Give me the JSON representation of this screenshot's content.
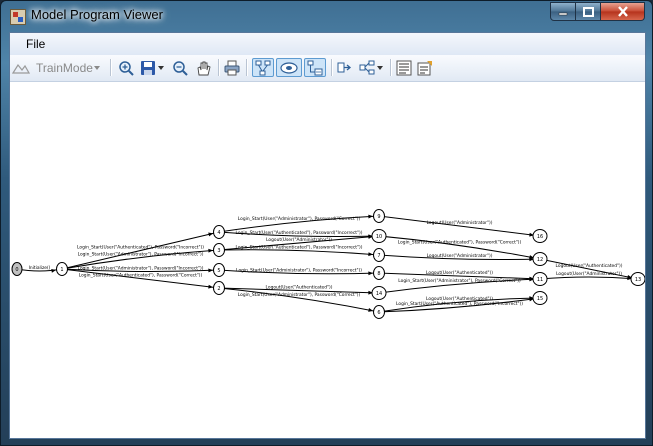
{
  "window": {
    "title": "Model Program Viewer"
  },
  "menubar": {
    "file": "File"
  },
  "toolbar": {
    "dropdown_value": "TrainMode",
    "buttons": [
      {
        "name": "zoom-in-icon",
        "pressed": false
      },
      {
        "name": "save-icon",
        "pressed": false
      },
      {
        "name": "zoom-out-icon",
        "pressed": false
      },
      {
        "name": "pan-hand-icon",
        "pressed": false
      },
      {
        "name": "print-icon",
        "pressed": false
      },
      {
        "name": "graph-layout-icon",
        "pressed": true
      },
      {
        "name": "state-view-icon",
        "pressed": true
      },
      {
        "name": "label-view-icon",
        "pressed": true
      },
      {
        "name": "direction-icon",
        "pressed": false
      },
      {
        "name": "graph-options-icon",
        "pressed": false
      },
      {
        "name": "list-icon",
        "pressed": false
      },
      {
        "name": "properties-icon",
        "pressed": false
      }
    ]
  },
  "graph": {
    "nodes": [
      "0",
      "1",
      "2",
      "3",
      "4",
      "5",
      "6",
      "7",
      "8",
      "9",
      "10",
      "11",
      "12",
      "13",
      "14",
      "15",
      "16"
    ],
    "edges": [
      {
        "from": "0",
        "to": "1",
        "label": "Initialize()"
      },
      {
        "from": "1",
        "to": "4",
        "label": "Login_Start(User(\"Authenticated\"), Password(\"Incorrect\"))"
      },
      {
        "from": "1",
        "to": "3",
        "label": "Login_Start(User(\"Administrator\"), Password(\"Incorrect\"))"
      },
      {
        "from": "1",
        "to": "5",
        "label": "Login_Start(User(\"Administrator\"), Password(\"Incorrect\"))"
      },
      {
        "from": "1",
        "to": "2",
        "label": "Login_Start(User(\"Authenticated\"), Password(\"Correct\"))"
      },
      {
        "from": "4",
        "to": "9",
        "label": "Login_Start(User(\"Administrator\"), Password(\"Correct\"))"
      },
      {
        "from": "4",
        "to": "10",
        "label": "Login_Start(User(\"Authenticated\"), Password(\"Incorrect\"))"
      },
      {
        "from": "3",
        "to": "10",
        "label": "Logout(User(\"Administrator\"))"
      },
      {
        "from": "3",
        "to": "7",
        "label": "Login_Start(User(\"Authenticated\"), Password(\"Incorrect\"))"
      },
      {
        "from": "5",
        "to": "8",
        "label": "Login_Start(User(\"Administrator\"), Password(\"Incorrect\"))"
      },
      {
        "from": "2",
        "to": "14",
        "label": "Logout(User(\"Authenticated\"))"
      },
      {
        "from": "2",
        "to": "6",
        "label": "Login_Start(User(\"Administrator\"), Password(\"Correct\"))"
      },
      {
        "from": "6",
        "to": "15",
        "label": "Login_Start(User(\"Authenticated\"), Password(\"Incorrect\"))"
      },
      {
        "from": "9",
        "to": "16",
        "label": "Logout(User(\"Administrator\"))"
      },
      {
        "from": "10",
        "to": "12",
        "label": "Login_Start(User(\"Authenticated\"), Password(\"Correct\"))"
      },
      {
        "from": "7",
        "to": "12",
        "label": "Logout(User(\"Administrator\"))"
      },
      {
        "from": "8",
        "to": "11",
        "label": "Logout(User(\"Authenticated\"))"
      },
      {
        "from": "14",
        "to": "11",
        "label": "Login_Start(User(\"Administrator\"), Password(\"Correct\"))"
      },
      {
        "from": "6",
        "to": "15",
        "label": "Logout(User(\"Authenticated\"))"
      },
      {
        "from": "12",
        "to": "13",
        "label": "Logout(User(\"Authenticated\"))"
      },
      {
        "from": "11",
        "to": "13",
        "label": "Logout(User(\"Administrator\"))"
      }
    ]
  },
  "colors": {
    "edge": "#000000",
    "node_fill": "#ffffff",
    "start_node_fill": "#c0c0c0",
    "accent": "#5d9bd1"
  }
}
